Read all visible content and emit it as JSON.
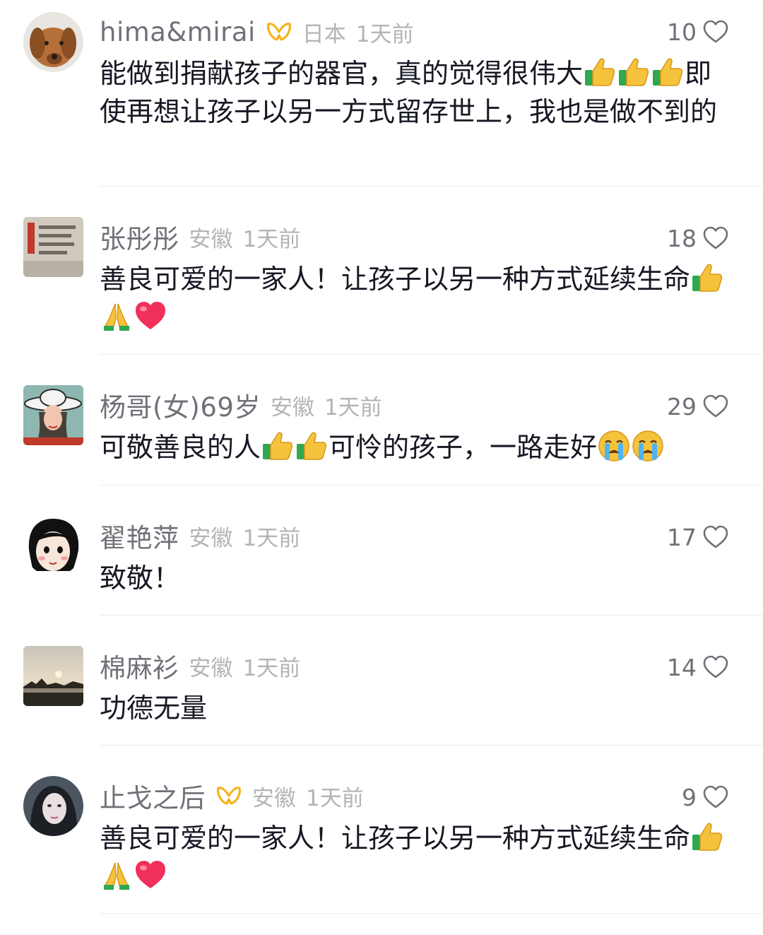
{
  "comments": [
    {
      "username": "hima&mirai",
      "badge": true,
      "location": "日本",
      "time": "1天前",
      "likes": "10",
      "avatar_icon": "dog-avatar",
      "text_parts": [
        "能做到捐献孩子的器官，真的觉得很伟大",
        "thumbs-up",
        "thumbs-up",
        "thumbs-up",
        "即使再想让孩子以另一方式留存世上，我也是做不到的"
      ]
    },
    {
      "username": "张彤彤",
      "badge": false,
      "location": "安徽",
      "time": "1天前",
      "likes": "18",
      "avatar_icon": "document-avatar",
      "text_parts": [
        "善良可爱的一家人！让孩子以另一种方式延续生命",
        "thumbs-up",
        "pray",
        "red-heart"
      ]
    },
    {
      "username": "杨哥(女)69岁",
      "badge": false,
      "location": "安徽",
      "time": "1天前",
      "likes": "29",
      "avatar_icon": "woman-hat-avatar",
      "text_parts": [
        "可敬善良的人",
        "thumbs-up",
        "thumbs-up",
        "可怜的孩子，一路走好",
        "crying-face",
        "crying-face"
      ]
    },
    {
      "username": "翟艳萍",
      "badge": false,
      "location": "安徽",
      "time": "1天前",
      "likes": "17",
      "avatar_icon": "cartoon-girl-avatar",
      "text_parts": [
        "致敬！"
      ]
    },
    {
      "username": "棉麻衫",
      "badge": false,
      "location": "安徽",
      "time": "1天前",
      "likes": "14",
      "avatar_icon": "sunset-avatar",
      "text_parts": [
        "功德无量"
      ]
    },
    {
      "username": "止戈之后",
      "badge": true,
      "location": "安徽",
      "time": "1天前",
      "likes": "9",
      "avatar_icon": "woman-portrait-avatar",
      "text_parts": [
        "善良可爱的一家人！让孩子以另一种方式延续生命",
        "thumbs-up",
        "pray",
        "red-heart"
      ]
    }
  ],
  "colors": {
    "username": "#6f7178",
    "meta": "#b3b4b8",
    "text": "#161823",
    "badge": "#f5b21c",
    "divider": "#ececee"
  }
}
